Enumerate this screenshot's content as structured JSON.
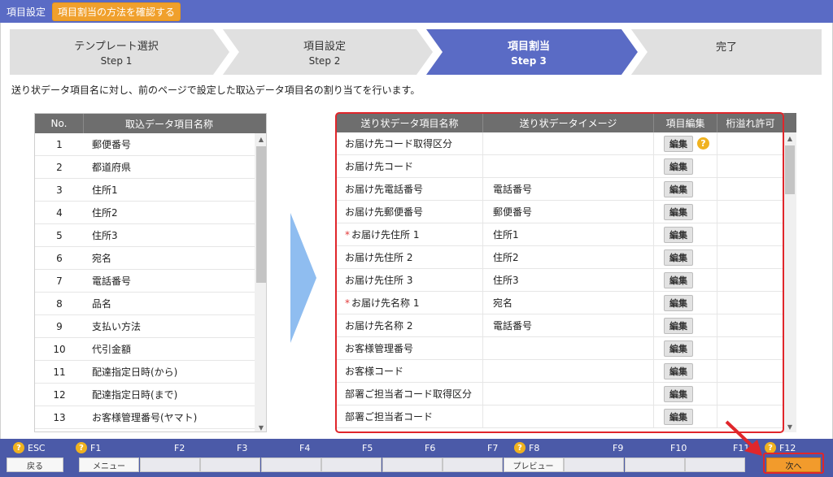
{
  "header": {
    "title": "項目設定",
    "help_button": "項目割当の方法を確認する"
  },
  "steps": [
    {
      "label": "テンプレート選択",
      "sub": "Step 1",
      "active": false
    },
    {
      "label": "項目設定",
      "sub": "Step 2",
      "active": false
    },
    {
      "label": "項目割当",
      "sub": "Step 3",
      "active": true
    },
    {
      "label": "完了",
      "sub": "",
      "active": false
    }
  ],
  "description": "送り状データ項目名に対し、前のページで設定した取込データ項目名の割り当てを行います。",
  "left_table": {
    "headers": [
      "No.",
      "取込データ項目名称"
    ],
    "rows": [
      [
        "1",
        "郵便番号"
      ],
      [
        "2",
        "都道府県"
      ],
      [
        "3",
        "住所1"
      ],
      [
        "4",
        "住所2"
      ],
      [
        "5",
        "住所3"
      ],
      [
        "6",
        "宛名"
      ],
      [
        "7",
        "電話番号"
      ],
      [
        "8",
        "品名"
      ],
      [
        "9",
        "支払い方法"
      ],
      [
        "10",
        "代引金額"
      ],
      [
        "11",
        "配達指定日時(から)"
      ],
      [
        "12",
        "配達指定日時(まで)"
      ],
      [
        "13",
        "お客様管理番号(ヤマト)"
      ]
    ]
  },
  "right_table": {
    "headers": [
      "送り状データ項目名称",
      "送り状データイメージ",
      "項目編集",
      "桁溢れ許可"
    ],
    "edit_label": "編集",
    "rows": [
      {
        "name": "お届け先コード取得区分",
        "image": "",
        "required": false,
        "help": true
      },
      {
        "name": "お届け先コード",
        "image": "",
        "required": false,
        "help": false
      },
      {
        "name": "お届け先電話番号",
        "image": "電話番号",
        "required": false,
        "help": false
      },
      {
        "name": "お届け先郵便番号",
        "image": "郵便番号",
        "required": false,
        "help": false
      },
      {
        "name": "お届け先住所 1",
        "image": "住所1",
        "required": true,
        "help": false
      },
      {
        "name": "お届け先住所 2",
        "image": "住所2",
        "required": false,
        "help": false
      },
      {
        "name": "お届け先住所 3",
        "image": "住所3",
        "required": false,
        "help": false
      },
      {
        "name": "お届け先名称 1",
        "image": "宛名",
        "required": true,
        "help": false
      },
      {
        "name": "お届け先名称 2",
        "image": "電話番号",
        "required": false,
        "help": false
      },
      {
        "name": "お客様管理番号",
        "image": "",
        "required": false,
        "help": false
      },
      {
        "name": "お客様コード",
        "image": "",
        "required": false,
        "help": false
      },
      {
        "name": "部署ご担当者コード取得区分",
        "image": "",
        "required": false,
        "help": false
      },
      {
        "name": "部署ご担当者コード",
        "image": "",
        "required": false,
        "help": false
      }
    ],
    "required_mark": "*",
    "help_mark": "?"
  },
  "footer": {
    "keys": [
      {
        "key": "ESC",
        "help": true,
        "button": "戻る"
      },
      {
        "key": "F1",
        "help": true,
        "button": "メニュー"
      },
      {
        "key": "F2",
        "help": false,
        "button": ""
      },
      {
        "key": "F3",
        "help": false,
        "button": ""
      },
      {
        "key": "F4",
        "help": false,
        "button": ""
      },
      {
        "key": "F5",
        "help": false,
        "button": ""
      },
      {
        "key": "F6",
        "help": false,
        "button": ""
      },
      {
        "key": "F7",
        "help": false,
        "button": ""
      },
      {
        "key": "F8",
        "help": true,
        "button": "プレビュー"
      },
      {
        "key": "F9",
        "help": false,
        "button": ""
      },
      {
        "key": "F10",
        "help": false,
        "button": ""
      },
      {
        "key": "F11",
        "help": false,
        "button": ""
      },
      {
        "key": "F12",
        "help": true,
        "button": "次へ"
      }
    ]
  },
  "colors": {
    "header": "#5a6bc5",
    "active_step": "#5a6bc5",
    "accent": "#f0a02c",
    "highlight": "#e0262b"
  }
}
